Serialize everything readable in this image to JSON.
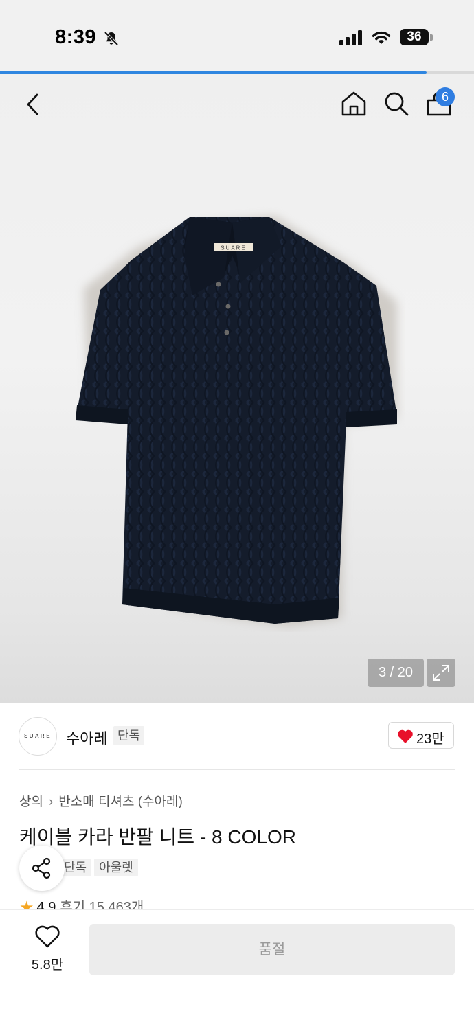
{
  "status_bar": {
    "time": "8:39",
    "battery": "36"
  },
  "page_load": {
    "progress": 0.9
  },
  "header": {
    "cart_count": "6"
  },
  "gallery": {
    "counter": "3 / 20",
    "shirt_label": "SUARE"
  },
  "brand": {
    "logo_text": "SUARE",
    "name": "수아레",
    "tag": "단독",
    "likes": "23만"
  },
  "product": {
    "breadcrumb": [
      "상의",
      "반소매 티셔츠 (수아레)"
    ],
    "title": "케이블 카라 반팔 니트 - 8 COLOR",
    "tags": [
      "단독",
      "아울렛"
    ],
    "rating": "4.9",
    "reviews": "후기 15,463개"
  },
  "bottom_bar": {
    "wish_count": "5.8만",
    "buy_label": "품절"
  },
  "colors": {
    "accent": "#2f7de1",
    "like_heart": "#e8102a",
    "star": "#f5a623",
    "shirt": "#141c2b"
  }
}
